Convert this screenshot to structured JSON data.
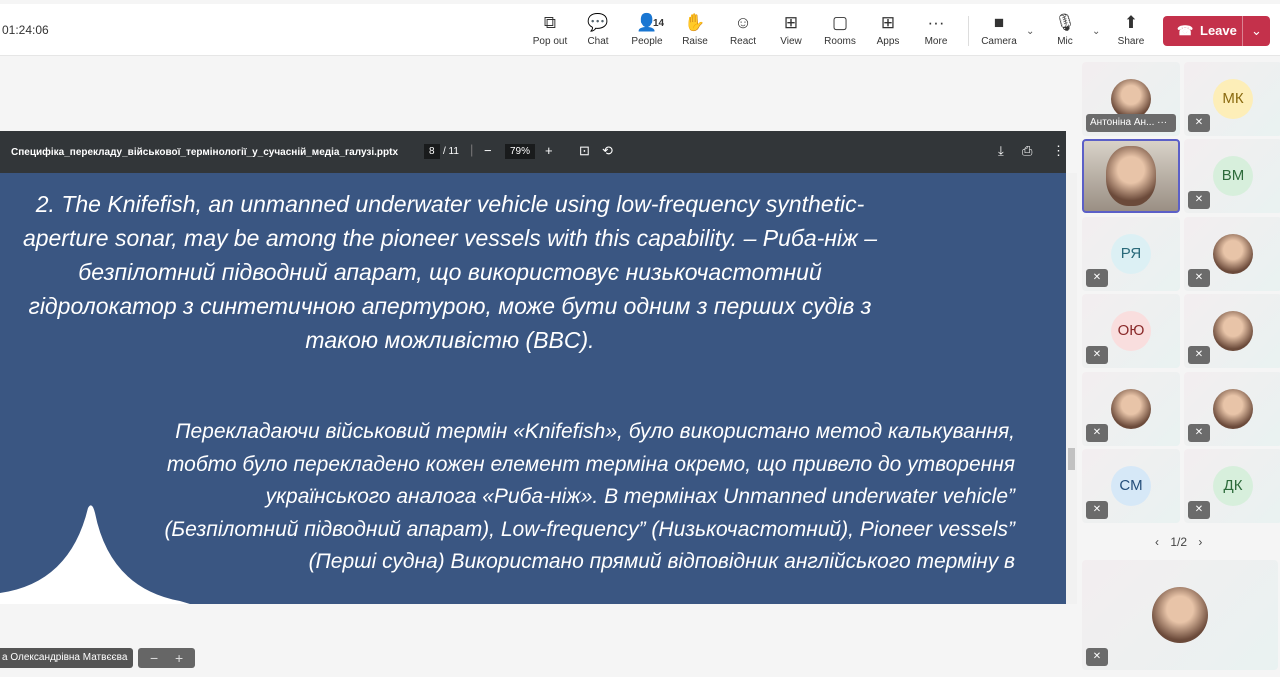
{
  "timer": "01:24:06",
  "toolbar": [
    {
      "label": "Pop out",
      "icon": "pop-out-icon",
      "glyph": "⧉"
    },
    {
      "label": "Chat",
      "icon": "chat-icon",
      "glyph": "💬"
    },
    {
      "label": "People",
      "icon": "people-icon",
      "glyph": "👤",
      "badge": "14"
    },
    {
      "label": "Raise",
      "icon": "raise-hand-icon",
      "glyph": "✋"
    },
    {
      "label": "React",
      "icon": "react-icon",
      "glyph": "☺"
    },
    {
      "label": "View",
      "icon": "view-icon",
      "glyph": "⊞"
    },
    {
      "label": "Rooms",
      "icon": "rooms-icon",
      "glyph": "▢"
    },
    {
      "label": "Apps",
      "icon": "apps-icon",
      "glyph": "⊞"
    },
    {
      "label": "More",
      "icon": "more-icon",
      "glyph": "···"
    },
    {
      "label": "Camera",
      "icon": "camera-off-icon",
      "glyph": "■"
    },
    {
      "label": "Mic",
      "icon": "mic-off-icon",
      "glyph": "🎙"
    },
    {
      "label": "Share",
      "icon": "share-icon",
      "glyph": "⬆"
    }
  ],
  "leave": {
    "label": "Leave",
    "color": "#c4314b"
  },
  "pdf": {
    "filename": "Специфіка_перекладу_військової_термінології_у_сучасній_медіа_галузі.pptx",
    "page": "8",
    "total": "/ 11",
    "zoom": "79%"
  },
  "slide": {
    "para1": "2. The Knifefish, an unmanned underwater vehicle using low-frequency synthetic-aperture sonar, may be among the pioneer vessels with this capability. – Риба-ніж – безпілотний підводний апарат, що використовує низькочастотний гідролокатор з синтетичною апертурою, може бути одним з перших судів з такою можливістю (BBC).",
    "para2": "Перекладаючи військовий термін «Knifefish», було використано метод калькування, тобто було перекладено кожен елемент терміна окремо, що привело до утворення українського аналога «Риба-ніж». В термінах Unmanned underwater vehicle” (Безпілотний підводний апарат), Low-frequency” (Низькочастотний), Pioneer vessels” (Перші судна) Використано прямий відповідник англійського терміну в",
    "background": "#3a5682"
  },
  "presenter_name": "а Олександрівна Матвєєва",
  "participants": [
    {
      "name": "Антоніна Ан...",
      "type": "photo"
    },
    {
      "initials": "МК",
      "bg": "#fdeeb8",
      "fg": "#8a6a10",
      "muted": true
    },
    {
      "type": "video",
      "selected": true
    },
    {
      "initials": "ВМ",
      "bg": "#d7efdc",
      "fg": "#2d6b3b",
      "muted": true
    },
    {
      "initials": "РЯ",
      "bg": "#dcf0f4",
      "fg": "#2a6a7a",
      "muted": true
    },
    {
      "type": "photo",
      "muted": true
    },
    {
      "initials": "ОЮ",
      "bg": "#f9dede",
      "fg": "#8a2a2a",
      "muted": true
    },
    {
      "type": "photo",
      "muted": true
    },
    {
      "type": "photo",
      "muted": true
    },
    {
      "type": "photo",
      "muted": true
    },
    {
      "initials": "СМ",
      "bg": "#d6e8f7",
      "fg": "#244e7a",
      "muted": true
    },
    {
      "initials": "ДК",
      "bg": "#d7efdc",
      "fg": "#2d6b3b",
      "muted": true
    }
  ],
  "pager": "1/2"
}
